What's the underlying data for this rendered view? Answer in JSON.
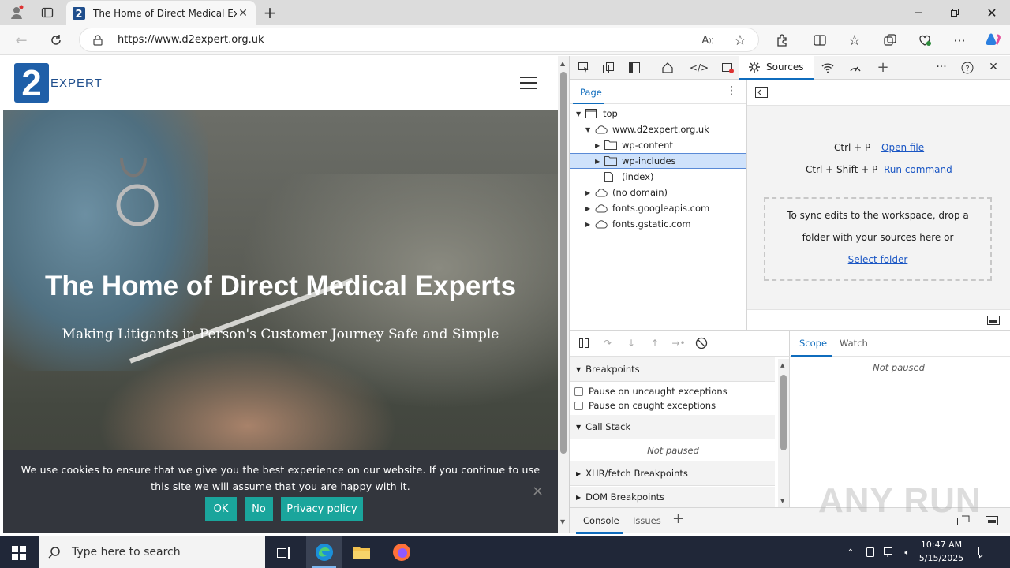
{
  "browser": {
    "tab_title": "The Home of Direct Medical Exp",
    "url": "https://www.d2expert.org.uk"
  },
  "site": {
    "logo_digit": "2",
    "logo_word": "EXPERT",
    "hero_title": "The Home of Direct Medical Experts",
    "hero_subtitle": "Making Litigants in Person's Customer Journey Safe and Simple",
    "cookie_text": "We use cookies to ensure that we give you the best experience on our website. If you continue to use this site we will assume that you are happy with it.",
    "cookie_ok": "OK",
    "cookie_no": "No",
    "cookie_privacy": "Privacy policy",
    "cookie_close": "×"
  },
  "devtools": {
    "active_tab": "Sources",
    "navigator_tab": "Page",
    "tree": [
      {
        "label": "top",
        "depth": 0,
        "expanded": true,
        "kind": "frame"
      },
      {
        "label": "www.d2expert.org.uk",
        "depth": 1,
        "expanded": true,
        "kind": "domain"
      },
      {
        "label": "wp-content",
        "depth": 2,
        "expanded": false,
        "kind": "folder"
      },
      {
        "label": "wp-includes",
        "depth": 2,
        "expanded": false,
        "kind": "folder",
        "selected": true
      },
      {
        "label": "(index)",
        "depth": 2,
        "kind": "file"
      },
      {
        "label": "(no domain)",
        "depth": 1,
        "expanded": false,
        "kind": "domain"
      },
      {
        "label": "fonts.googleapis.com",
        "depth": 1,
        "expanded": false,
        "kind": "domain"
      },
      {
        "label": "fonts.gstatic.com",
        "depth": 1,
        "expanded": false,
        "kind": "domain"
      }
    ],
    "shortcut1_keys": "Ctrl + P",
    "shortcut1_action": "Open file",
    "shortcut2_keys": "Ctrl + Shift + P",
    "shortcut2_action": "Run command",
    "workspace_line1": "To sync edits to the workspace, drop a",
    "workspace_line2": "folder with your sources here or",
    "workspace_link": "Select folder",
    "debugger": {
      "breakpoints": "Breakpoints",
      "pause_uncaught": "Pause on uncaught exceptions",
      "pause_caught": "Pause on caught exceptions",
      "call_stack": "Call Stack",
      "not_paused": "Not paused",
      "xhr": "XHR/fetch Breakpoints",
      "dom": "DOM Breakpoints"
    },
    "scope_tab": "Scope",
    "watch_tab": "Watch",
    "scope_status": "Not paused",
    "drawer_console": "Console",
    "drawer_issues": "Issues"
  },
  "taskbar": {
    "search_placeholder": "Type here to search",
    "time": "10:47 AM",
    "date": "5/15/2025"
  },
  "watermark": "ANY RUN"
}
